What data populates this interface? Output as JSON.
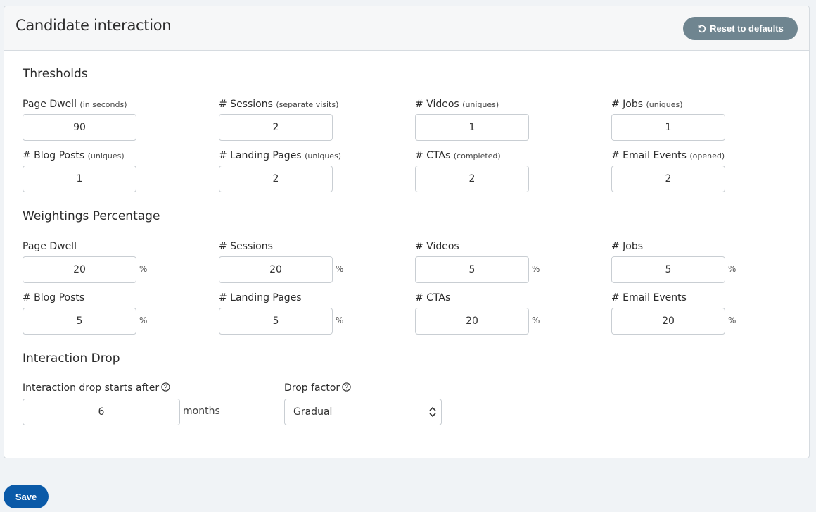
{
  "header": {
    "title": "Candidate interaction",
    "reset_label": "Reset to defaults"
  },
  "thresholds": {
    "title": "Thresholds",
    "fields": [
      {
        "label": "Page Dwell",
        "note": "(in seconds)",
        "value": "90"
      },
      {
        "label": "# Sessions",
        "note": "(separate visits)",
        "value": "2"
      },
      {
        "label": "# Videos",
        "note": "(uniques)",
        "value": "1"
      },
      {
        "label": "# Jobs",
        "note": "(uniques)",
        "value": "1"
      },
      {
        "label": "# Blog Posts",
        "note": "(uniques)",
        "value": "1"
      },
      {
        "label": "# Landing Pages",
        "note": "(uniques)",
        "value": "2"
      },
      {
        "label": "# CTAs",
        "note": "(completed)",
        "value": "2"
      },
      {
        "label": "# Email Events",
        "note": "(opened)",
        "value": "2"
      }
    ]
  },
  "weightings": {
    "title": "Weightings Percentage",
    "unit": "%",
    "fields": [
      {
        "label": "Page Dwell",
        "value": "20"
      },
      {
        "label": "# Sessions",
        "value": "20"
      },
      {
        "label": "# Videos",
        "value": "5"
      },
      {
        "label": "# Jobs",
        "value": "5"
      },
      {
        "label": "# Blog Posts",
        "value": "5"
      },
      {
        "label": "# Landing Pages",
        "value": "5"
      },
      {
        "label": "# CTAs",
        "value": "20"
      },
      {
        "label": "# Email Events",
        "value": "20"
      }
    ]
  },
  "drop": {
    "title": "Interaction Drop",
    "starts_label": "Interaction drop starts after",
    "starts_value": "6",
    "starts_unit": "months",
    "factor_label": "Drop factor",
    "factor_value": "Gradual"
  },
  "footer": {
    "save_label": "Save"
  },
  "colors": {
    "reset_button": "#6f8590",
    "save_button": "#0b5aa8",
    "background": "#f0f3f6"
  }
}
